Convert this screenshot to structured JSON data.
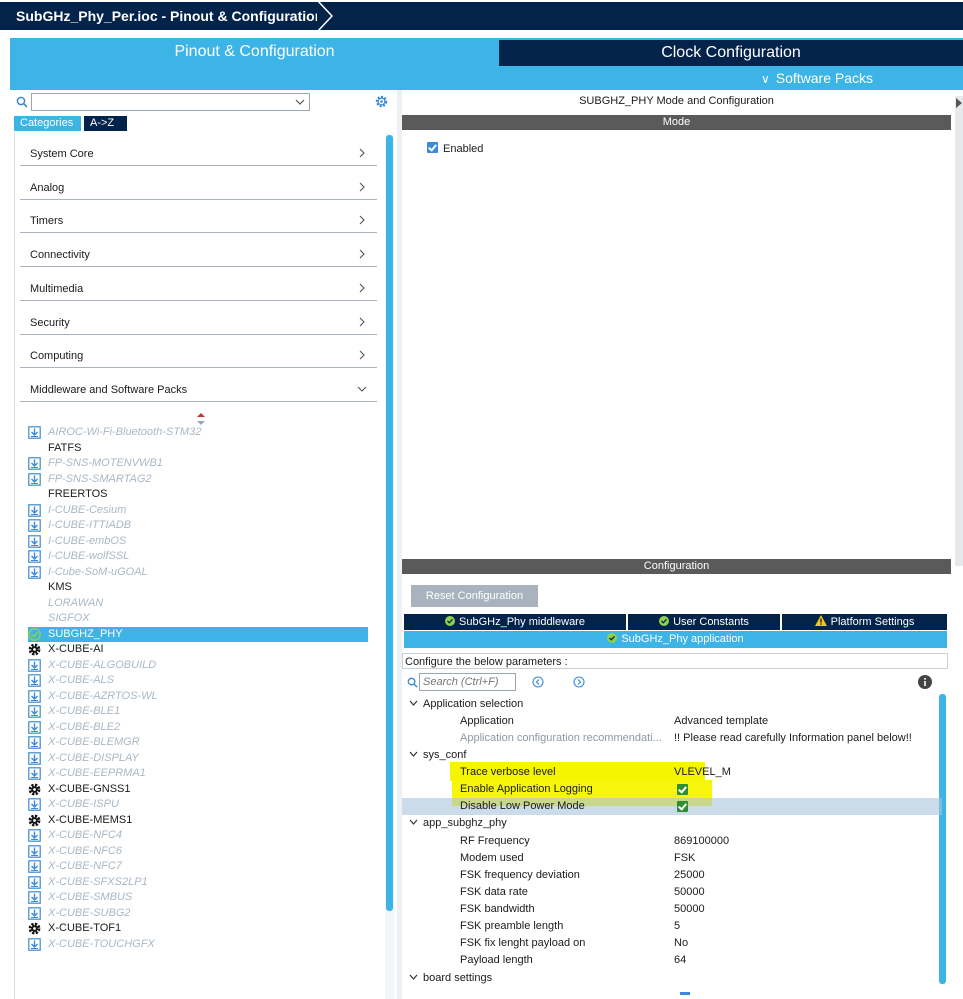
{
  "window": {
    "breadcrumb": "SubGHz_Phy_Per.ioc - Pinout & Configuration"
  },
  "main_tabs": {
    "pinout": "Pinout & Configuration",
    "clock": "Clock Configuration",
    "software_packs": "Software Packs"
  },
  "left": {
    "search_value": "",
    "tab_categories": "Categories",
    "tab_az": "A->Z",
    "categories": [
      {
        "label": "System Core"
      },
      {
        "label": "Analog"
      },
      {
        "label": "Timers"
      },
      {
        "label": "Connectivity"
      },
      {
        "label": "Multimedia"
      },
      {
        "label": "Security"
      },
      {
        "label": "Computing"
      },
      {
        "label": "Middleware and Software Packs"
      }
    ],
    "middleware": [
      {
        "label": "AIROC-Wi-Fi-Bluetooth-STM32",
        "state": "dis",
        "icon": "download-icon"
      },
      {
        "label": "FATFS",
        "state": "plain",
        "icon": ""
      },
      {
        "label": "FP-SNS-MOTENVWB1",
        "state": "dis",
        "icon": "download-icon"
      },
      {
        "label": "FP-SNS-SMARTAG2",
        "state": "dis",
        "icon": "download-icon"
      },
      {
        "label": "FREERTOS",
        "state": "plain",
        "icon": ""
      },
      {
        "label": "I-CUBE-Cesium",
        "state": "dis",
        "icon": "download-icon"
      },
      {
        "label": "I-CUBE-ITTIADB",
        "state": "dis",
        "icon": "download-icon"
      },
      {
        "label": "I-CUBE-embOS",
        "state": "dis",
        "icon": "download-icon"
      },
      {
        "label": "I-CUBE-wolfSSL",
        "state": "dis",
        "icon": "download-icon"
      },
      {
        "label": "I-Cube-SoM-uGOAL",
        "state": "dis",
        "icon": "download-icon"
      },
      {
        "label": "KMS",
        "state": "plain",
        "icon": ""
      },
      {
        "label": "LORAWAN",
        "state": "gray",
        "icon": ""
      },
      {
        "label": "SIGFOX",
        "state": "gray",
        "icon": ""
      },
      {
        "label": "SUBGHZ_PHY",
        "state": "sel",
        "icon": "check-circle-icon"
      },
      {
        "label": "X-CUBE-AI",
        "state": "gear",
        "icon": "gear-icon"
      },
      {
        "label": "X-CUBE-ALGOBUILD",
        "state": "dis",
        "icon": "download-icon"
      },
      {
        "label": "X-CUBE-ALS",
        "state": "dis",
        "icon": "download-icon"
      },
      {
        "label": "X-CUBE-AZRTOS-WL",
        "state": "dis",
        "icon": "download-icon"
      },
      {
        "label": "X-CUBE-BLE1",
        "state": "dis",
        "icon": "download-icon"
      },
      {
        "label": "X-CUBE-BLE2",
        "state": "dis",
        "icon": "download-icon"
      },
      {
        "label": "X-CUBE-BLEMGR",
        "state": "dis",
        "icon": "download-icon"
      },
      {
        "label": "X-CUBE-DISPLAY",
        "state": "dis",
        "icon": "download-icon"
      },
      {
        "label": "X-CUBE-EEPRMA1",
        "state": "dis",
        "icon": "download-icon"
      },
      {
        "label": "X-CUBE-GNSS1",
        "state": "gear",
        "icon": "gear-icon"
      },
      {
        "label": "X-CUBE-ISPU",
        "state": "dis",
        "icon": "download-icon"
      },
      {
        "label": "X-CUBE-MEMS1",
        "state": "gear",
        "icon": "gear-icon"
      },
      {
        "label": "X-CUBE-NFC4",
        "state": "dis",
        "icon": "download-icon"
      },
      {
        "label": "X-CUBE-NFC6",
        "state": "dis",
        "icon": "download-icon"
      },
      {
        "label": "X-CUBE-NFC7",
        "state": "dis",
        "icon": "download-icon"
      },
      {
        "label": "X-CUBE-SFXS2LP1",
        "state": "dis",
        "icon": "download-icon"
      },
      {
        "label": "X-CUBE-SMBUS",
        "state": "dis",
        "icon": "download-icon"
      },
      {
        "label": "X-CUBE-SUBG2",
        "state": "dis",
        "icon": "download-icon"
      },
      {
        "label": "X-CUBE-TOF1",
        "state": "gear",
        "icon": "gear-icon"
      },
      {
        "label": "X-CUBE-TOUCHGFX",
        "state": "dis",
        "icon": "download-icon"
      }
    ]
  },
  "right": {
    "mode_title": "SUBGHZ_PHY Mode and Configuration",
    "mode_bar": "Mode",
    "enabled_label": "Enabled",
    "config_bar": "Configuration",
    "reset_button": "Reset Configuration",
    "tabs": {
      "middleware": "SubGHz_Phy middleware",
      "user_constants": "User Constants",
      "platform_settings": "Platform Settings",
      "application": "SubGHz_Phy application"
    },
    "configure_text": "Configure the below parameters :",
    "search_placeholder": "Search (Ctrl+F)",
    "groups": {
      "app_selection": "Application selection",
      "sys_conf": "sys_conf",
      "app_subghz_phy": "app_subghz_phy",
      "board_settings": "board settings"
    },
    "params": {
      "application": {
        "name": "Application",
        "value": "Advanced template"
      },
      "app_config_rec": {
        "name": "Application configuration recommendati...",
        "value": "!! Please read carefully Information panel below!!"
      },
      "trace_verbose": {
        "name": "Trace verbose level",
        "value": "VLEVEL_M"
      },
      "enable_logging": {
        "name": "Enable Application Logging"
      },
      "disable_lowpower": {
        "name": "Disable Low Power Mode"
      },
      "rf_frequency": {
        "name": "RF Frequency",
        "value": "869100000"
      },
      "modem_used": {
        "name": "Modem used",
        "value": "FSK"
      },
      "fsk_freq_dev": {
        "name": "FSK frequency deviation",
        "value": "25000"
      },
      "fsk_data_rate": {
        "name": "FSK data rate",
        "value": "50000"
      },
      "fsk_bandwidth": {
        "name": "FSK bandwidth",
        "value": "50000"
      },
      "fsk_preamble": {
        "name": "FSK preamble length",
        "value": "5"
      },
      "fsk_fix_len": {
        "name": "FSK fix lenght payload on",
        "value": "No"
      },
      "payload_len": {
        "name": "Payload length",
        "value": "64"
      }
    }
  },
  "colors": {
    "navy": "#03234b",
    "accent": "#3cb4e6",
    "highlight": "#f5f500"
  }
}
